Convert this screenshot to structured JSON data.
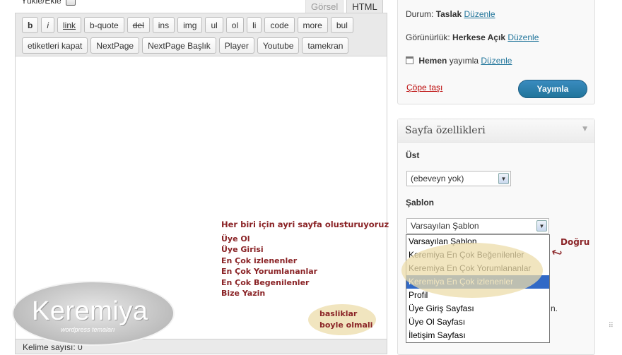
{
  "editor": {
    "upload_label": "Yükle/Ekle",
    "tabs": [
      "Görsel",
      "HTML"
    ],
    "quicktags_row1": [
      "b",
      "i",
      "link",
      "b-quote",
      "del",
      "ins",
      "img",
      "ul",
      "ol",
      "li",
      "code",
      "more",
      "bul"
    ],
    "quicktags_row2": [
      "etiketleri kapat",
      "NextPage",
      "NextPage Başlık",
      "Player",
      "Youtube",
      "tamekran"
    ],
    "word_count": "Kelime sayısı: 0"
  },
  "annotation": {
    "heading": "Her biri için ayri sayfa olusturuyoruz",
    "items": [
      "Üye Ol",
      "Üye Girisi",
      "En Çok izlenenler",
      "En Çok Yorumlananlar",
      "En Çok Begenilenler",
      "Bize Yazin"
    ],
    "note_line1": "basliklar",
    "note_line2": "boyle olmali",
    "correct_label": "Doğru"
  },
  "logo": {
    "name": "Keremiya",
    "subtitle": "wordpress temaları"
  },
  "publish": {
    "status_label": "Durum:",
    "status_value": "Taslak",
    "visibility_label": "Görünürlük:",
    "visibility_value": "Herkese Açık",
    "schedule_value": "Hemen",
    "schedule_suffix": "yayımla",
    "edit_link": "Düzenle",
    "trash_link": "Çöpe taşı",
    "publish_button": "Yayımla"
  },
  "page_attributes": {
    "title": "Sayfa özellikleri",
    "parent_label": "Üst",
    "parent_value": "(ebeveyn yok)",
    "template_label": "Şablon",
    "template_value": "Varsayılan Şablon",
    "template_options": [
      "Varsayılan Şablon",
      "Keremiya En Çok Beğenilenler",
      "Keremiya En Çok Yorumlananlar",
      "Keremiya En Çok izlenenler",
      "Profil",
      "Üye Giriş Sayfası",
      "Üye Ol Sayfası",
      "İletişim Sayfası"
    ],
    "template_highlighted_index": 3,
    "partial_text": "n."
  }
}
